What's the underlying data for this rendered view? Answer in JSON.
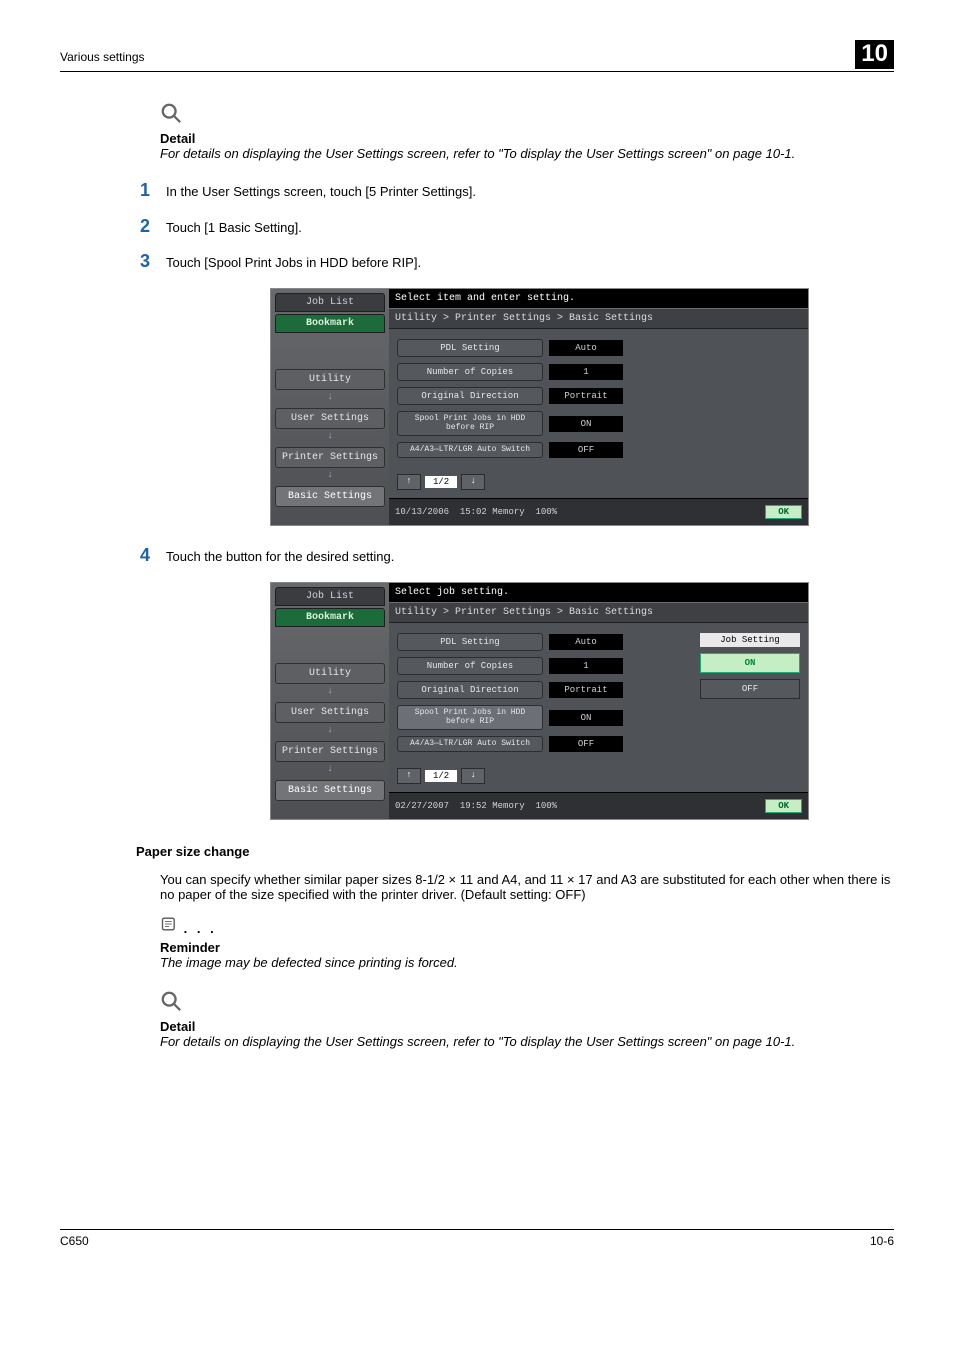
{
  "header": {
    "left": "Various settings",
    "right": "10"
  },
  "detail1": {
    "label": "Detail",
    "text": "For details on displaying the User Settings screen, refer to \"To display the User Settings screen\" on page 10-1."
  },
  "steps": {
    "s1": "In the User Settings screen, touch [5 Printer Settings].",
    "s2": "Touch [1 Basic Setting].",
    "s3": "Touch [Spool Print Jobs in HDD before RIP].",
    "s4": "Touch the button for the desired setting."
  },
  "screenshot1": {
    "top": "Select item and enter setting.",
    "breadcrumb": "Utility > Printer Settings > Basic Settings",
    "side": {
      "joblist": "Job List",
      "bookmark": "Bookmark",
      "utility": "Utility",
      "user": "User Settings",
      "printer": "Printer Settings",
      "basic": "Basic Settings"
    },
    "opts": {
      "pdl": {
        "label": "PDL Setting",
        "val": "Auto"
      },
      "copies": {
        "label": "Number of Copies",
        "val": "1"
      },
      "orient": {
        "label": "Original Direction",
        "val": "Portrait"
      },
      "spool": {
        "label": "Spool Print Jobs\nin HDD before RIP",
        "val": "ON"
      },
      "auto": {
        "label": "A4/A3⇔LTR/LGR\nAuto Switch",
        "val": "OFF"
      }
    },
    "pager": "1/2",
    "status": {
      "date": "10/13/2006",
      "time": "15:02",
      "mem": "Memory",
      "pct": "100%"
    },
    "ok": "OK"
  },
  "screenshot2": {
    "top": "Select job setting.",
    "breadcrumb": "Utility > Printer Settings > Basic Settings",
    "side": {
      "joblist": "Job List",
      "bookmark": "Bookmark",
      "utility": "Utility",
      "user": "User Settings",
      "printer": "Printer Settings",
      "basic": "Basic Settings"
    },
    "opts": {
      "pdl": {
        "label": "PDL Setting",
        "val": "Auto"
      },
      "copies": {
        "label": "Number of Copies",
        "val": "1"
      },
      "orient": {
        "label": "Original Direction",
        "val": "Portrait"
      },
      "spool": {
        "label": "Spool Print Jobs\nin HDD before RIP",
        "val": "ON"
      },
      "auto": {
        "label": "A4/A3⇔LTR/LGR\nAuto Switch",
        "val": "OFF"
      }
    },
    "pager": "1/2",
    "job": {
      "head": "Job Setting",
      "on": "ON",
      "off": "OFF"
    },
    "status": {
      "date": "02/27/2007",
      "time": "19:52",
      "mem": "Memory",
      "pct": "100%"
    },
    "ok": "OK"
  },
  "section2": {
    "head": "Paper size change",
    "body": "You can specify whether similar paper sizes 8-1/2 × 11 and A4, and 11 × 17 and A3 are substituted for each other when there is no paper of the size specified with the printer driver. (Default setting: OFF)"
  },
  "reminder": {
    "label": "Reminder",
    "text": "The image may be defected since printing is forced."
  },
  "detail2": {
    "label": "Detail",
    "text": "For details on displaying the User Settings screen, refer to \"To display the User Settings screen\" on page 10-1."
  },
  "footer": {
    "left": "C650",
    "right": "10-6"
  }
}
